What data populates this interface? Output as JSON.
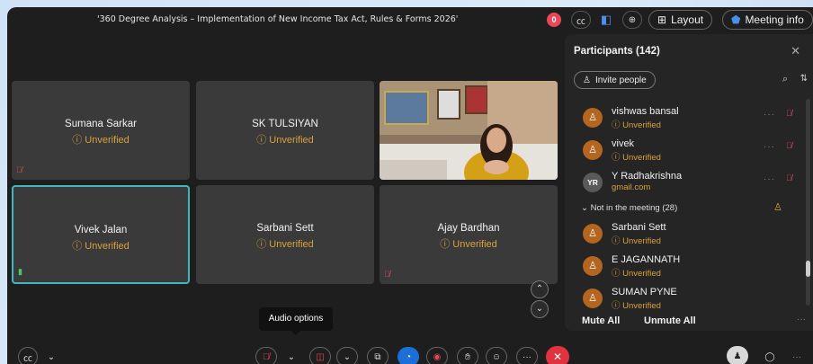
{
  "meeting": {
    "title": "'360 Degree Analysis – Implementation of New Income Tax Act, Rules & Forms 2026'",
    "rec_label": "0"
  },
  "header": {
    "layout_label": "Layout",
    "meeting_info_label": "Meeting info"
  },
  "tiles": [
    {
      "name": "Sumana Sarkar",
      "status": "Unverified",
      "muted": true
    },
    {
      "name": "SK TULSIYAN",
      "status": "Unverified",
      "muted": false
    },
    {
      "name": "",
      "status": "",
      "video": true
    },
    {
      "name": "Vivek Jalan",
      "status": "Unverified",
      "active": true
    },
    {
      "name": "Sarbani Sett",
      "status": "Unverified",
      "muted": false
    },
    {
      "name": "Ajay Bardhan",
      "status": "Unverified",
      "muted": true
    }
  ],
  "participants_panel": {
    "title": "Participants (142)",
    "invite_label": "Invite people",
    "in_meeting": [
      {
        "name": "vishwas bansal",
        "sub": "Unverified",
        "avatar": "person"
      },
      {
        "name": "vivek",
        "sub": "Unverified",
        "avatar": "person"
      },
      {
        "name": "Y Radhakrishna",
        "sub": "gmail.com",
        "avatar": "YR"
      }
    ],
    "section_label": "Not in the meeting (28)",
    "not_in_meeting": [
      {
        "name": "Sarbani Sett",
        "sub": "Unverified"
      },
      {
        "name": "E JAGANNATH",
        "sub": "Unverified"
      },
      {
        "name": "SUMAN PYNE",
        "sub": "Unverified"
      }
    ],
    "mute_all_label": "Mute All",
    "unmute_all_label": "Unmute All"
  },
  "tooltip": {
    "label": "Audio options"
  },
  "colors": {
    "accent_teal": "#3fb7c2",
    "unverified": "#d9a13b",
    "end_call": "#e0323f",
    "muted_red": "#e0515d"
  }
}
